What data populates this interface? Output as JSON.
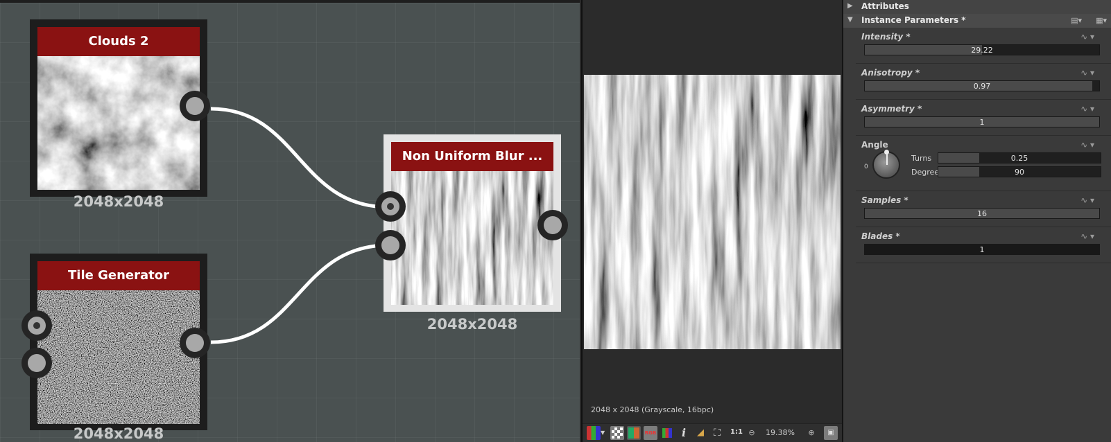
{
  "graph": {
    "nodes": [
      {
        "id": "clouds",
        "title": "Clouds 2",
        "resolution": "2048x2048"
      },
      {
        "id": "tile",
        "title": "Tile Generator",
        "resolution": "2048x2048"
      },
      {
        "id": "blur",
        "title": "Non Uniform Blur ...",
        "resolution": "2048x2048"
      }
    ]
  },
  "viewer": {
    "image_info": "2048 x 2048 (Grayscale, 16bpc)",
    "zoom": "19.38%",
    "one_to_one": "1:1",
    "toolbar_icons": [
      "rgb-channels-icon",
      "checker-icon",
      "color-chart-icon",
      "rgb-toggle-icon",
      "color-picker-icon",
      "info-icon",
      "histogram-icon",
      "fit-icon",
      "one-to-one-icon",
      "zoom-out-icon",
      "zoom-in-icon",
      "lock-icon"
    ]
  },
  "attributes": {
    "attributes_header": "Attributes",
    "instance_header": "Instance Parameters *",
    "params": [
      {
        "name": "Intensity *",
        "value": "29.22",
        "fill": 0.5
      },
      {
        "name": "Anisotropy *",
        "value": "0.97",
        "fill": 0.97
      },
      {
        "name": "Asymmetry *",
        "value": "1",
        "fill": 1.0
      },
      {
        "name": "Angle",
        "turns_label": "Turns",
        "turns_value": "0.25",
        "degrees_label": "Degrees",
        "degrees_value": "90",
        "dial_zero": "0",
        "fill": 0.25
      },
      {
        "name": "Samples *",
        "value": "16",
        "fill": 1.0
      },
      {
        "name": "Blades *",
        "value": "1",
        "fill": 0.0
      }
    ]
  }
}
